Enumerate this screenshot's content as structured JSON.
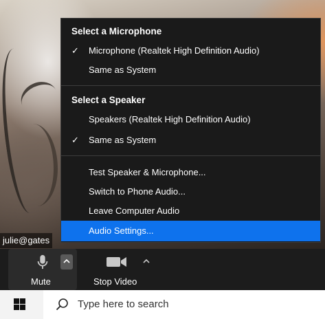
{
  "video": {
    "participant_name": "julie@gates"
  },
  "menu": {
    "microphone_heading": "Select a Microphone",
    "microphone_items": [
      {
        "label": "Microphone (Realtek High Definition Audio)",
        "checked": true
      },
      {
        "label": "Same as System",
        "checked": false
      }
    ],
    "speaker_heading": "Select a Speaker",
    "speaker_items": [
      {
        "label": "Speakers (Realtek High Definition Audio)",
        "checked": false
      },
      {
        "label": "Same as System",
        "checked": true
      }
    ],
    "actions": [
      {
        "label": "Test Speaker & Microphone..."
      },
      {
        "label": "Switch to Phone Audio..."
      },
      {
        "label": "Leave Computer Audio"
      },
      {
        "label": "Audio Settings...",
        "highlighted": true
      }
    ],
    "check_glyph": "✓",
    "highlight_color": "#0e72ed"
  },
  "toolbar": {
    "mute_label": "Mute",
    "stop_video_label": "Stop Video",
    "mute_icon": "microphone-icon",
    "video_icon": "video-camera-icon"
  },
  "taskbar": {
    "start_icon": "windows-logo-icon",
    "search_placeholder": "Type here to search"
  }
}
